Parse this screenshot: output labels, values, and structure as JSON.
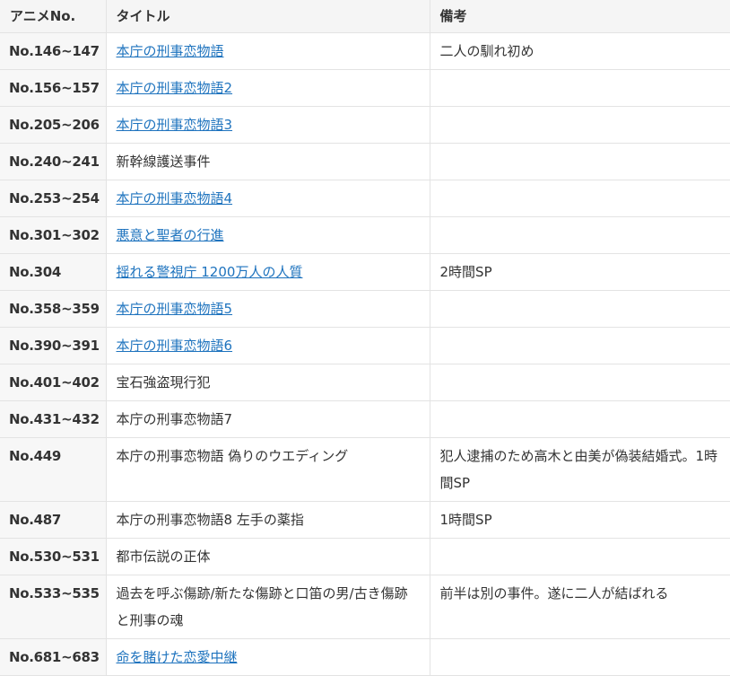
{
  "headers": [
    "アニメNo.",
    "タイトル",
    "備考"
  ],
  "rows": [
    {
      "no": "No.146~147",
      "title": "本庁の刑事恋物語",
      "link": true,
      "note": "二人の馴れ初め"
    },
    {
      "no": "No.156~157",
      "title": "本庁の刑事恋物語2",
      "link": true,
      "note": ""
    },
    {
      "no": "No.205~206",
      "title": "本庁の刑事恋物語3",
      "link": true,
      "note": ""
    },
    {
      "no": "No.240~241",
      "title": "新幹線護送事件",
      "link": false,
      "note": ""
    },
    {
      "no": "No.253~254",
      "title": "本庁の刑事恋物語4",
      "link": true,
      "note": ""
    },
    {
      "no": "No.301~302",
      "title": "悪意と聖者の行進",
      "link": true,
      "note": ""
    },
    {
      "no": "No.304",
      "title": "揺れる警視庁 1200万人の人質",
      "link": true,
      "note": "2時間SP"
    },
    {
      "no": "No.358~359",
      "title": "本庁の刑事恋物語5",
      "link": true,
      "note": ""
    },
    {
      "no": "No.390~391",
      "title": "本庁の刑事恋物語6",
      "link": true,
      "note": ""
    },
    {
      "no": "No.401~402",
      "title": "宝石強盗現行犯",
      "link": false,
      "note": ""
    },
    {
      "no": "No.431~432",
      "title": "本庁の刑事恋物語7",
      "link": false,
      "note": ""
    },
    {
      "no": "No.449",
      "title": "本庁の刑事恋物語 偽りのウエディング",
      "link": false,
      "note": "犯人逮捕のため高木と由美が偽装結婚式。1時間SP"
    },
    {
      "no": "No.487",
      "title": "本庁の刑事恋物語8 左手の薬指",
      "link": false,
      "note": "1時間SP"
    },
    {
      "no": "No.530~531",
      "title": "都市伝説の正体",
      "link": false,
      "note": ""
    },
    {
      "no": "No.533~535",
      "title": "過去を呼ぶ傷跡/新たな傷跡と口笛の男/古き傷跡と刑事の魂",
      "link": false,
      "note": "前半は別の事件。遂に二人が結ばれる"
    },
    {
      "no": "No.681~683",
      "title": "命を賭けた恋愛中継",
      "link": true,
      "note": ""
    }
  ],
  "colors": {
    "link": "#1e73be",
    "text": "#333333",
    "header_bg": "#f5f5f5"
  }
}
